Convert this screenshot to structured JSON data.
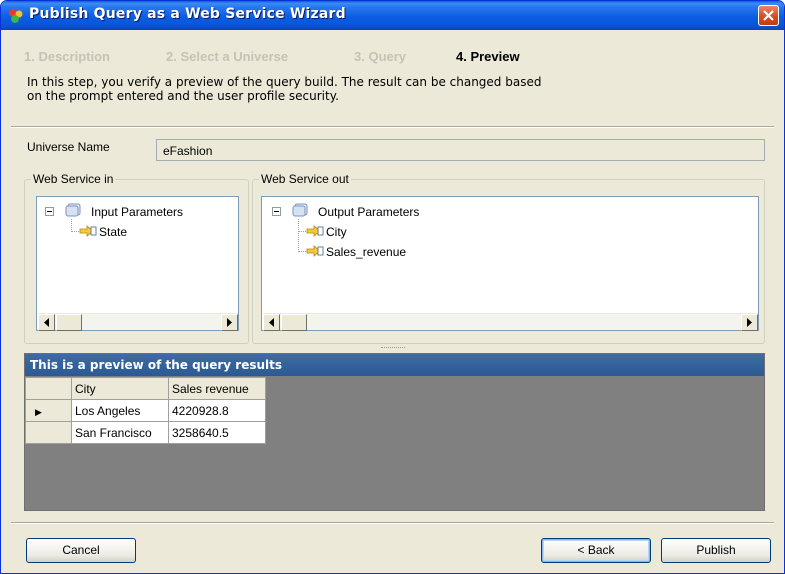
{
  "window": {
    "title": "Publish Query as a Web Service Wizard",
    "close_icon": "close-icon"
  },
  "steps": [
    {
      "label": "1. Description",
      "active": false
    },
    {
      "label": "2. Select a Universe",
      "active": false
    },
    {
      "label": "3. Query",
      "active": false
    },
    {
      "label": "4. Preview",
      "active": true
    }
  ],
  "description": "In this step, you verify a preview of the query build. The result can be changed based on the prompt entered and the user profile security.",
  "universe": {
    "label": "Universe Name",
    "value": "eFashion"
  },
  "web_service_in": {
    "title": "Web Service in",
    "root": "Input Parameters",
    "children": [
      "State"
    ]
  },
  "web_service_out": {
    "title": "Web Service out",
    "root": "Output Parameters",
    "children": [
      "City",
      "Sales_revenue"
    ]
  },
  "preview": {
    "header": "This is a preview of the query results",
    "columns": [
      "City",
      "Sales revenue"
    ],
    "rows": [
      [
        "Los Angeles",
        "4220928.8"
      ],
      [
        "San Francisco",
        "3258640.5"
      ]
    ],
    "current_row_marker": "▶"
  },
  "buttons": {
    "cancel": "Cancel",
    "back": "< Back",
    "publish": "Publish"
  },
  "colors": {
    "titlebar": "#0a5fd8",
    "preview_header": "#2b5a92",
    "preview_background": "#808080",
    "dialog_background": "#ece9d8"
  }
}
